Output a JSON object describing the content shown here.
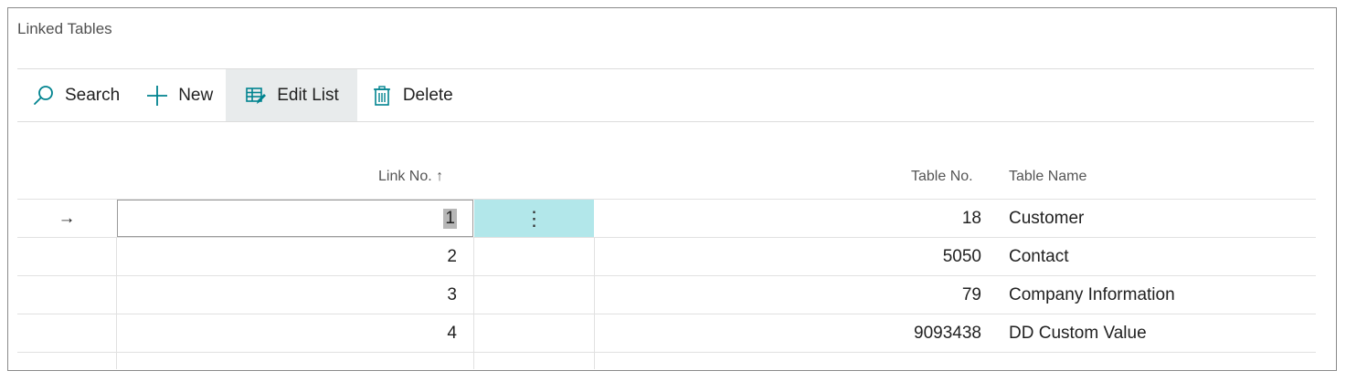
{
  "page": {
    "title": "Linked Tables"
  },
  "toolbar": {
    "search_label": "Search",
    "new_label": "New",
    "edit_list_label": "Edit List",
    "delete_label": "Delete",
    "search_icon": "search-icon",
    "new_icon": "plus-icon",
    "edit_list_icon": "edit-list-icon",
    "delete_icon": "trash-icon",
    "accent_color": "#00838f"
  },
  "table": {
    "columns": {
      "link_no": "Link No.",
      "link_no_sort": "↑",
      "table_no": "Table No.",
      "table_name": "Table Name"
    },
    "current_row_marker": "→",
    "row_menu_glyph": "⋮",
    "rows": [
      {
        "link_no": "1",
        "table_no": "18",
        "table_name": "Customer"
      },
      {
        "link_no": "2",
        "table_no": "5050",
        "table_name": "Contact"
      },
      {
        "link_no": "3",
        "table_no": "79",
        "table_name": "Company Information"
      },
      {
        "link_no": "4",
        "table_no": "9093438",
        "table_name": "DD Custom Value"
      }
    ],
    "selected_cell_color": "#b2e7ea"
  }
}
